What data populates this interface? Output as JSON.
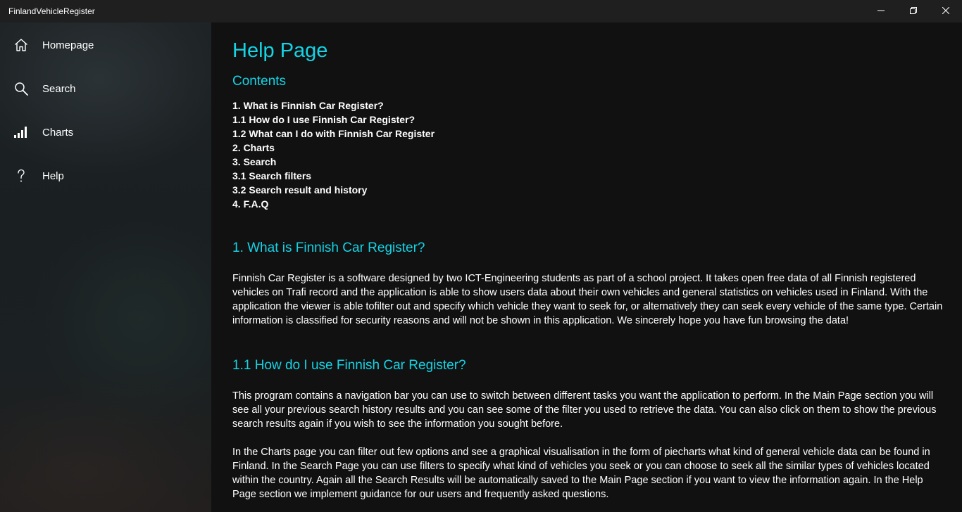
{
  "window": {
    "title": "FinlandVehicleRegister",
    "controls": {
      "minimize": "minimize-icon",
      "maximize": "restore-icon",
      "close": "close-icon"
    }
  },
  "sidebar": {
    "items": [
      {
        "label": "Homepage",
        "icon": "home-icon"
      },
      {
        "label": "Search",
        "icon": "search-icon"
      },
      {
        "label": "Charts",
        "icon": "signal-bars-icon"
      },
      {
        "label": "Help",
        "icon": "question-icon"
      }
    ]
  },
  "main": {
    "title": "Help Page",
    "contents_heading": "Contents",
    "toc": [
      "1. What is Finnish Car Register?",
      "1.1 How do I use Finnish Car Register?",
      "1.2 What can I do with Finnish Car Register",
      "2. Charts",
      "3. Search",
      "3.1 Search filters",
      "3.2 Search result and history",
      "4. F.A.Q"
    ],
    "sections": [
      {
        "heading": "1. What is Finnish Car Register?",
        "paragraphs": [
          "Finnish Car Register is a software designed by two ICT-Engineering students as part of a school project. It takes open free data of all Finnish registered vehicles on Trafi record and the application is able to show users data about their own vehicles and general statistics on vehicles used in Finland. With the application the viewer is able tofilter out and specify which vehicle they want to seek for, or alternatively they can seek every vehicle of the same type. Certain information is classified for security reasons and will not be shown in this application. We sincerely hope you have fun browsing the data!"
        ]
      },
      {
        "heading": "1.1 How do I use Finnish Car Register?",
        "paragraphs": [
          "This program contains a navigation bar you can use to switch between different tasks you want the application to perform. In the Main Page section you will see all your previous search history results and you can see some of the filter you used to retrieve the data. You can also click on them to show the previous search results again if you wish to see the information you sought before.",
          "In the Charts page you can filter out few options and see a graphical visualisation in the form of piecharts what kind of general vehicle data can be found in Finland. In the Search Page you can use filters to specify what kind of vehicles you seek or you can choose to seek all the similar types of vehicles located within the country. Again all the Search Results will be automatically saved to the Main Page section if you want to view the information again. In the Help Page section we implement guidance for our users and frequently asked questions."
        ]
      }
    ]
  }
}
